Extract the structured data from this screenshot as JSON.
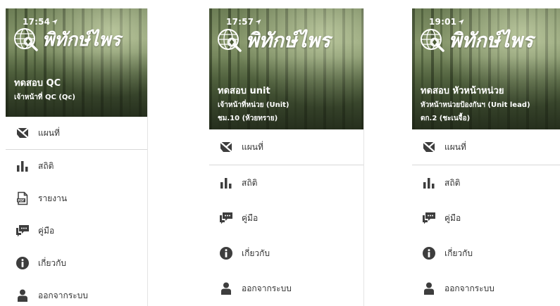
{
  "screens": [
    {
      "time": "17:54",
      "logo_text": "พิทักษ์ไพร",
      "user_name": "ทดสอบ QC",
      "user_role": "เจ้าหน้าที่ QC (Qc)",
      "user_unit": "",
      "menu": [
        "แผนที่",
        "สถิติ",
        "รายงาน",
        "คู่มือ",
        "เกี่ยวกับ",
        "ออกจากระบบ"
      ]
    },
    {
      "time": "17:57",
      "logo_text": "พิทักษ์ไพร",
      "user_name": "ทดสอบ unit",
      "user_role": "เจ้าหน้าที่หน่วย (Unit)",
      "user_unit": "ชม.10 (ห้วยทราย)",
      "menu": [
        "แผนที่",
        "สถิติ",
        "คู่มือ",
        "เกี่ยวกับ",
        "ออกจากระบบ"
      ]
    },
    {
      "time": "19:01",
      "logo_text": "พิทักษ์ไพร",
      "user_name": "ทดสอบ หัวหน้าหน่วย",
      "user_role": "หัวหน้าหน่วยป้องกันฯ (Unit lead)",
      "user_unit": "ตก.2 (ชะเนจื้อ)",
      "menu": [
        "แผนที่",
        "สถิติ",
        "คู่มือ",
        "เกี่ยวกับ",
        "ออกจากระบบ"
      ]
    }
  ],
  "icons": {
    "map": "map-icon",
    "stats": "bar-chart-icon",
    "report": "pdf-file-icon",
    "manual": "chat-bubble-icon",
    "about": "info-icon",
    "logout": "user-icon"
  },
  "colors": {
    "icon": "#3d3d3d",
    "text": "#333333",
    "header_text": "#ffffff",
    "divider": "#d8d8d8"
  }
}
